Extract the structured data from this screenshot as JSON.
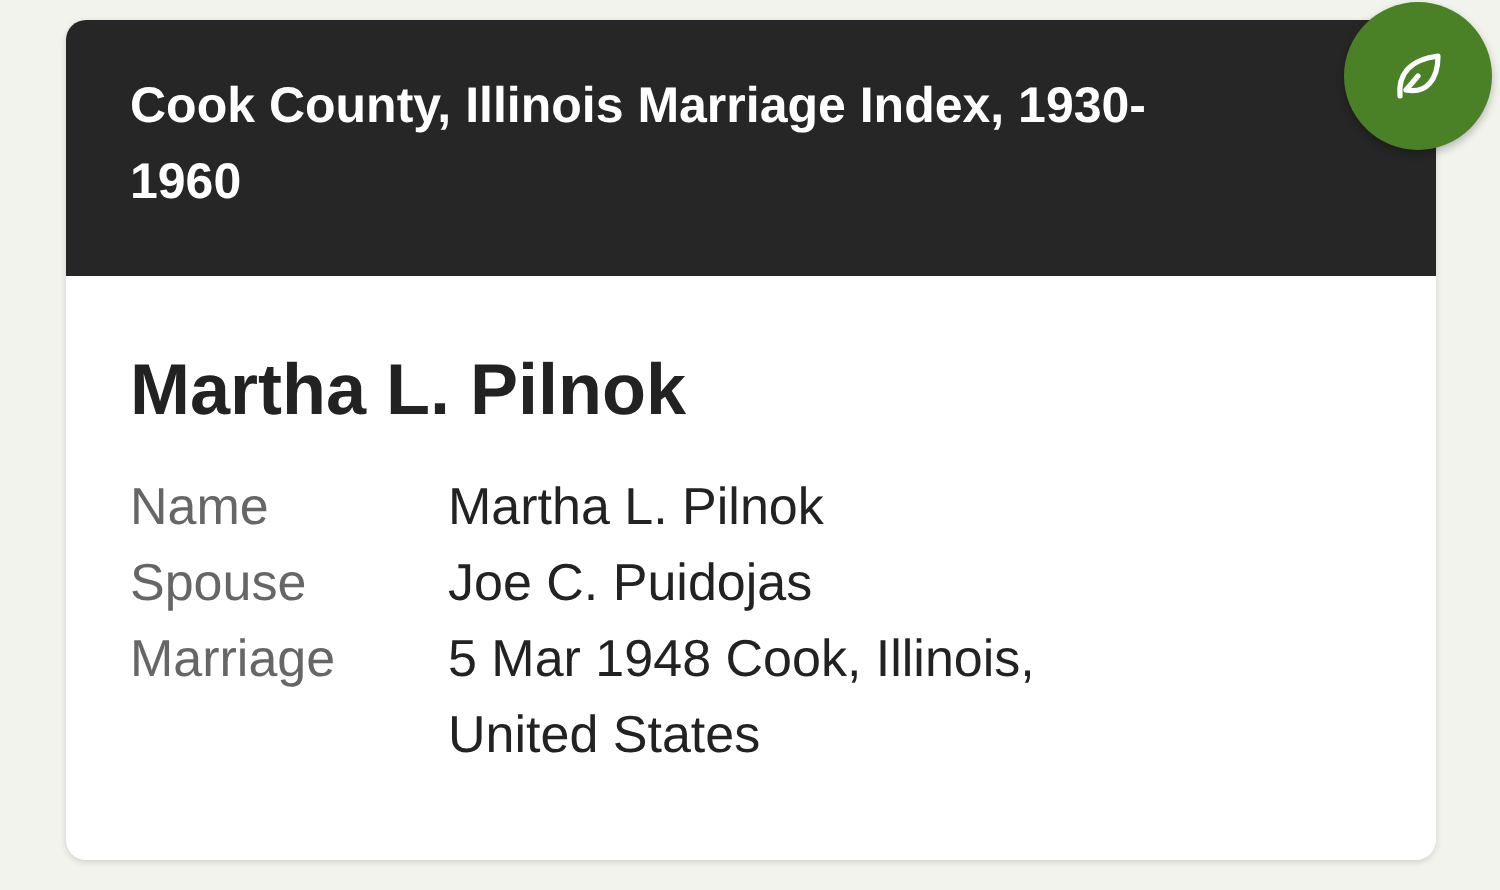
{
  "card": {
    "collection_title": "Cook County, Illinois Marriage Index, 1930-1960",
    "person_name": "Martha L. Pilnok",
    "facts": [
      {
        "label": "Name",
        "value": "Martha L. Pilnok"
      },
      {
        "label": "Spouse",
        "value": "Joe C. Puidojas"
      },
      {
        "label": "Marriage",
        "value": "5 Mar 1948 Cook, Illinois, United States"
      }
    ]
  }
}
